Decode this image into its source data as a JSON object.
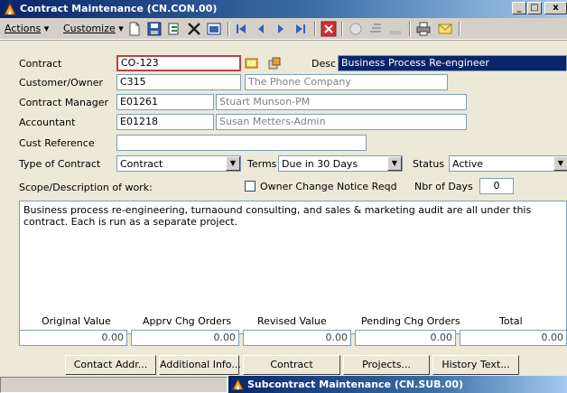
{
  "window": {
    "title": "Contract Maintenance (CN.CON.00)"
  },
  "titlebar_buttons": {
    "minimize": "_",
    "maximize": "□",
    "close": "x"
  },
  "menu": {
    "actions": "Actions",
    "customize": "Customize"
  },
  "toolbar_icons": [
    "new-icon",
    "save-icon",
    "copy-icon",
    "delete-icon",
    "note-icon",
    "first-icon",
    "prev-icon",
    "next-icon",
    "last-icon",
    "cancel-icon",
    "find-icon",
    "tools-icon",
    "link-icon",
    "print-icon",
    "mail-icon"
  ],
  "form": {
    "contract_label": "Contract",
    "contract_value": "CO-123",
    "desc_label": "Desc",
    "desc_value": "Business Process Re-engineer",
    "customer_label": "Customer/Owner",
    "customer_id": "C315",
    "customer_name": "The Phone Company",
    "manager_label": "Contract Manager",
    "manager_id": "E01261",
    "manager_name": "Stuart Munson-PM",
    "accountant_label": "Accountant",
    "accountant_id": "E01218",
    "accountant_name": "Susan Metters-Admin",
    "custref_label": "Cust Reference",
    "custref_value": "",
    "type_label": "Type of Contract",
    "type_value": "Contract",
    "terms_label": "Terms",
    "terms_value": "Due in 30 Days",
    "status_label": "Status",
    "status_value": "Active",
    "scope_label": "Scope/Description of work:",
    "owner_change_label": "Owner Change Notice Reqd",
    "owner_change_checked": false,
    "nbr_days_label": "Nbr of Days",
    "nbr_days_value": "0",
    "scope_text": "Business process re-engineering, turnaound consulting, and sales & marketing audit are all under this contract. Each is run as a separate project."
  },
  "totals": {
    "original_label": "Original Value",
    "original_value": "0.00",
    "apprv_label": "Apprv Chg Orders",
    "apprv_value": "0.00",
    "revised_label": "Revised Value",
    "revised_value": "0.00",
    "pending_label": "Pending Chg Orders",
    "pending_value": "0.00",
    "total_label": "Total",
    "total_value": "0.00"
  },
  "buttons": {
    "contact_addr": "Contact Addr...",
    "additional_info": "Additional Info...",
    "contract": "Contract",
    "projects": "Projects...",
    "history_text": "History Text..."
  },
  "subwindow": {
    "title": "Subcontract Maintenance (CN.SUB.00)"
  },
  "colors": {
    "title_start": "#0a246a",
    "title_end": "#a6caf0",
    "form_bg": "#ece9d8",
    "error_border": "#c04040"
  }
}
